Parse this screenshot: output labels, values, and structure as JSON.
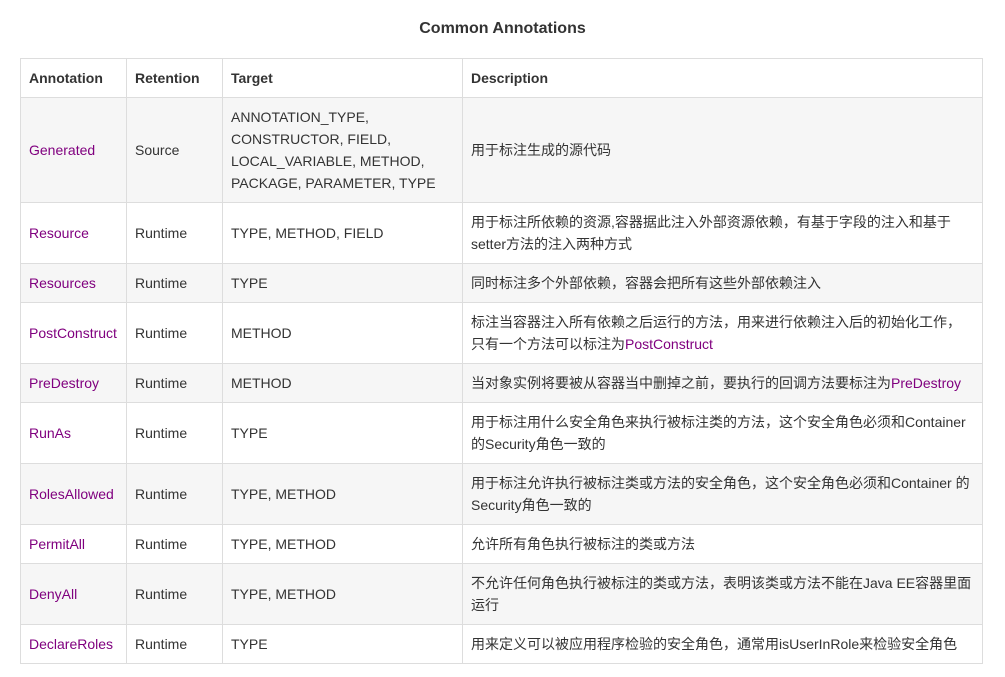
{
  "caption": "Common Annotations",
  "columns": [
    "Annotation",
    "Retention",
    "Target",
    "Description"
  ],
  "colors": {
    "annotation_link": "#80007f",
    "text": "#333333",
    "border": "#dddddd",
    "row_stripe": "#f6f6f6"
  },
  "rows": [
    {
      "name": "Generated",
      "retention": "Source",
      "target_lines": [
        "ANNOTATION_TYPE,",
        "CONSTRUCTOR, FIELD,",
        "LOCAL_VARIABLE, METHOD,",
        "PACKAGE, PARAMETER, TYPE"
      ],
      "description": "用于标注生成的源代码"
    },
    {
      "name": "Resource",
      "retention": "Runtime",
      "target": "TYPE, METHOD, FIELD",
      "description_lines": [
        "用于标注所依赖的资源,容器据此注入外部资源依赖，有基于字段的注入和基于",
        "setter方法的注入两种方式"
      ]
    },
    {
      "name": "Resources",
      "retention": "Runtime",
      "target": "TYPE",
      "description": "同时标注多个外部依赖，容器会把所有这些外部依赖注入"
    },
    {
      "name": "PostConstruct",
      "retention": "Runtime",
      "target": "METHOD",
      "description_line1": "标注当容器注入所有依赖之后运行的方法，用来进行依赖注入后的初始化工作，",
      "description_line2_prefix": "只有一个方法可以标注为",
      "description_line2_link": "PostConstruct"
    },
    {
      "name": "PreDestroy",
      "retention": "Runtime",
      "target": "METHOD",
      "description_prefix": "当对象实例将要被从容器当中删掉之前，要执行的回调方法要标注为",
      "description_link": "PreDestroy"
    },
    {
      "name": "RunAs",
      "retention": "Runtime",
      "target": "TYPE",
      "description_lines": [
        "用于标注用什么安全角色来执行被标注类的方法，这个安全角色必须和Container",
        "的Security角色一致的"
      ]
    },
    {
      "name": "RolesAllowed",
      "retention": "Runtime",
      "target": "TYPE, METHOD",
      "description_lines": [
        "用于标注允许执行被标注类或方法的安全角色，这个安全角色必须和Container 的",
        "Security角色一致的"
      ]
    },
    {
      "name": "PermitAll",
      "retention": "Runtime",
      "target": "TYPE, METHOD",
      "description": "允许所有角色执行被标注的类或方法"
    },
    {
      "name": "DenyAll",
      "retention": "Runtime",
      "target": "TYPE, METHOD",
      "description_lines": [
        "不允许任何角色执行被标注的类或方法，表明该类或方法不能在Java EE容器里面",
        "运行"
      ]
    },
    {
      "name": "DeclareRoles",
      "retention": "Runtime",
      "target": "TYPE",
      "description": "用来定义可以被应用程序检验的安全角色，通常用isUserInRole来检验安全角色"
    }
  ]
}
